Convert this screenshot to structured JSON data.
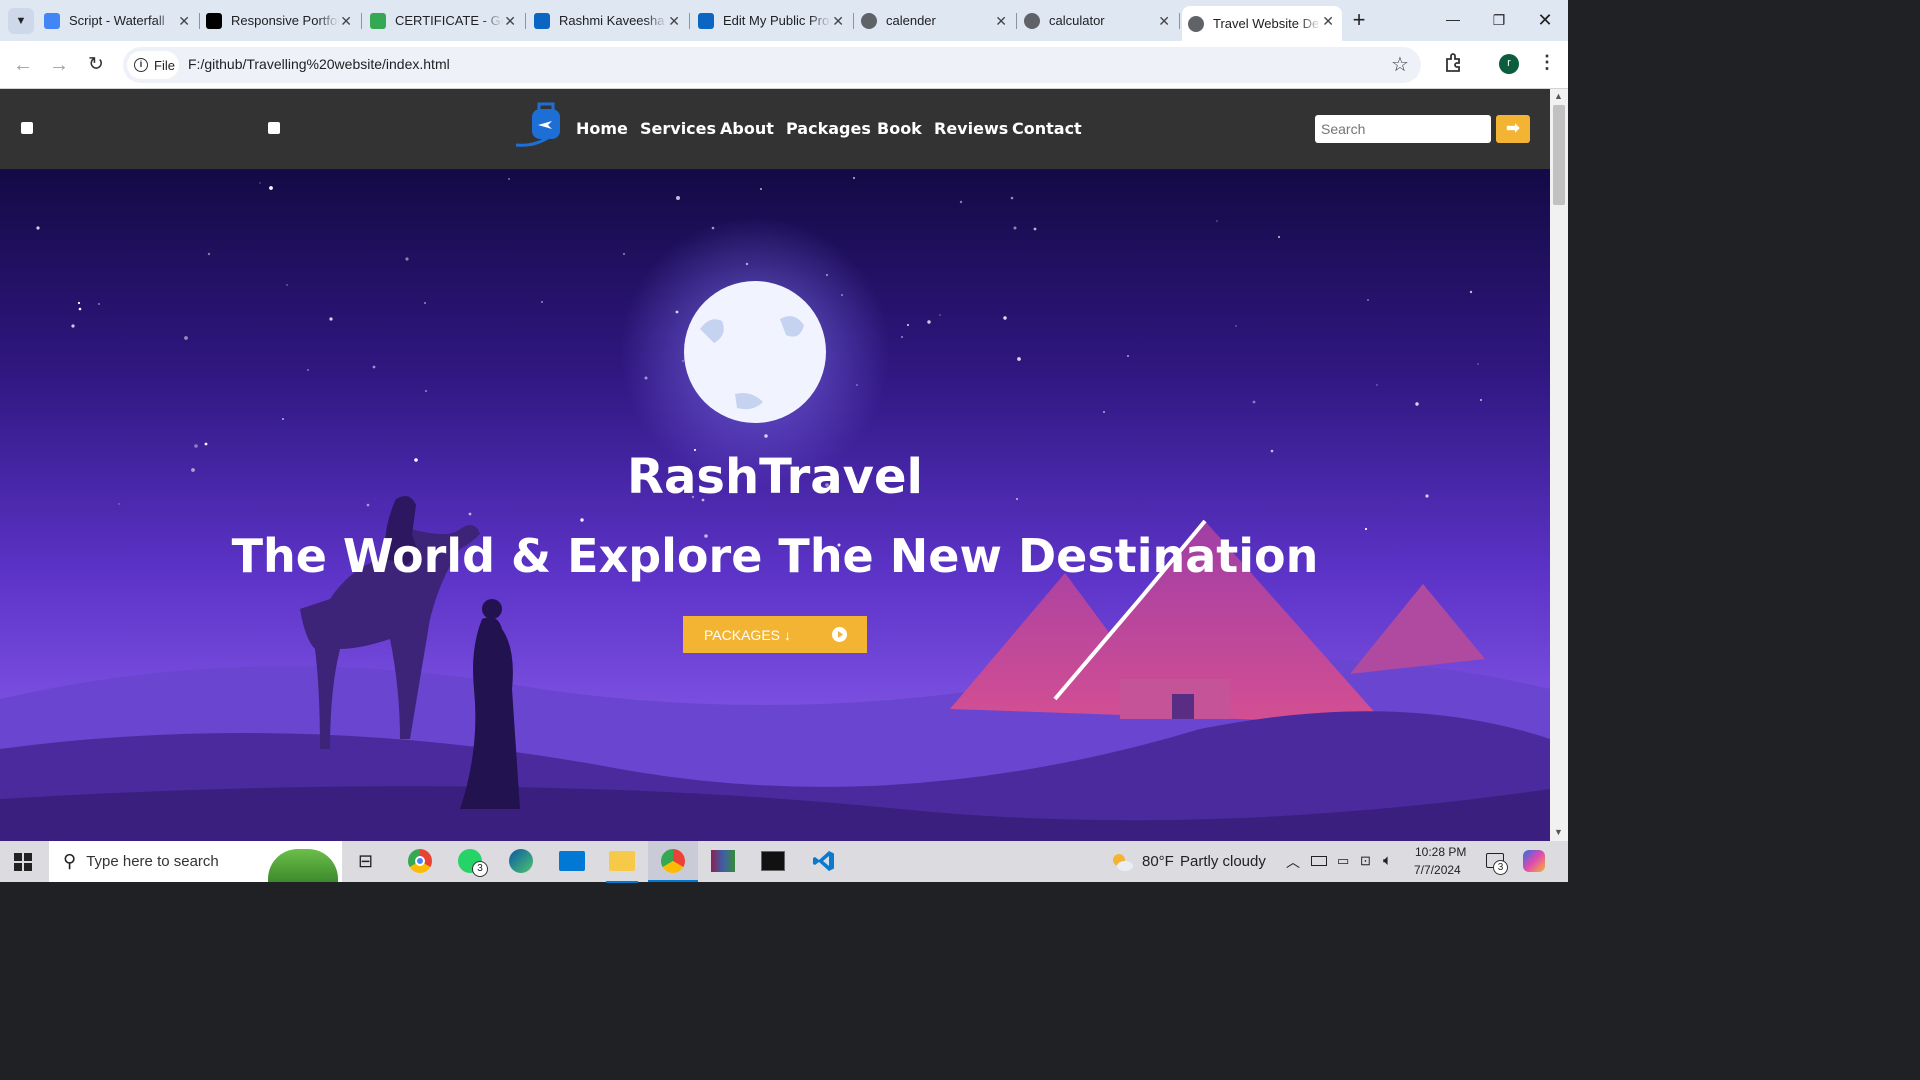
{
  "browser": {
    "tabs": [
      {
        "title": "Script - Waterfall",
        "favicon": "docs-icon",
        "color": "#4285f4"
      },
      {
        "title": "Responsive Portfolio",
        "favicon": "v-icon",
        "color": "#000000"
      },
      {
        "title": "CERTIFICATE - Google Drive",
        "favicon": "drive-icon",
        "color": "#34a853"
      },
      {
        "title": "Rashmi Kaveesha",
        "favicon": "linkedin-icon",
        "color": "#0a66c2"
      },
      {
        "title": "Edit My Public Profile",
        "favicon": "linkedin-icon",
        "color": "#0a66c2"
      },
      {
        "title": "calender",
        "favicon": "globe-icon",
        "color": "#5f6368"
      },
      {
        "title": "calculator",
        "favicon": "globe-icon",
        "color": "#5f6368"
      },
      {
        "title": "Travel Website Design",
        "favicon": "globe-icon",
        "color": "#5f6368",
        "active": true
      }
    ],
    "chip": "File",
    "url": "F:/github/Travelling%20website/index.html",
    "profile_initial": "r"
  },
  "site": {
    "brand_color": "#f4b433",
    "nav": [
      "Home",
      "Services",
      "About",
      "Packages",
      "Book",
      "Reviews",
      "Contact"
    ],
    "search_placeholder": "Search",
    "hero_title": "RashTravel",
    "hero_subtitle": "The World & Explore The New Destination",
    "cta": "PACKAGES"
  },
  "taskbar": {
    "search_placeholder": "Type here to search",
    "weather_temp": "80°F",
    "weather_text": "Partly cloudy",
    "time": "10:28 PM",
    "date": "7/7/2024",
    "whatsapp_badge": "3",
    "notif_badge": "3"
  }
}
